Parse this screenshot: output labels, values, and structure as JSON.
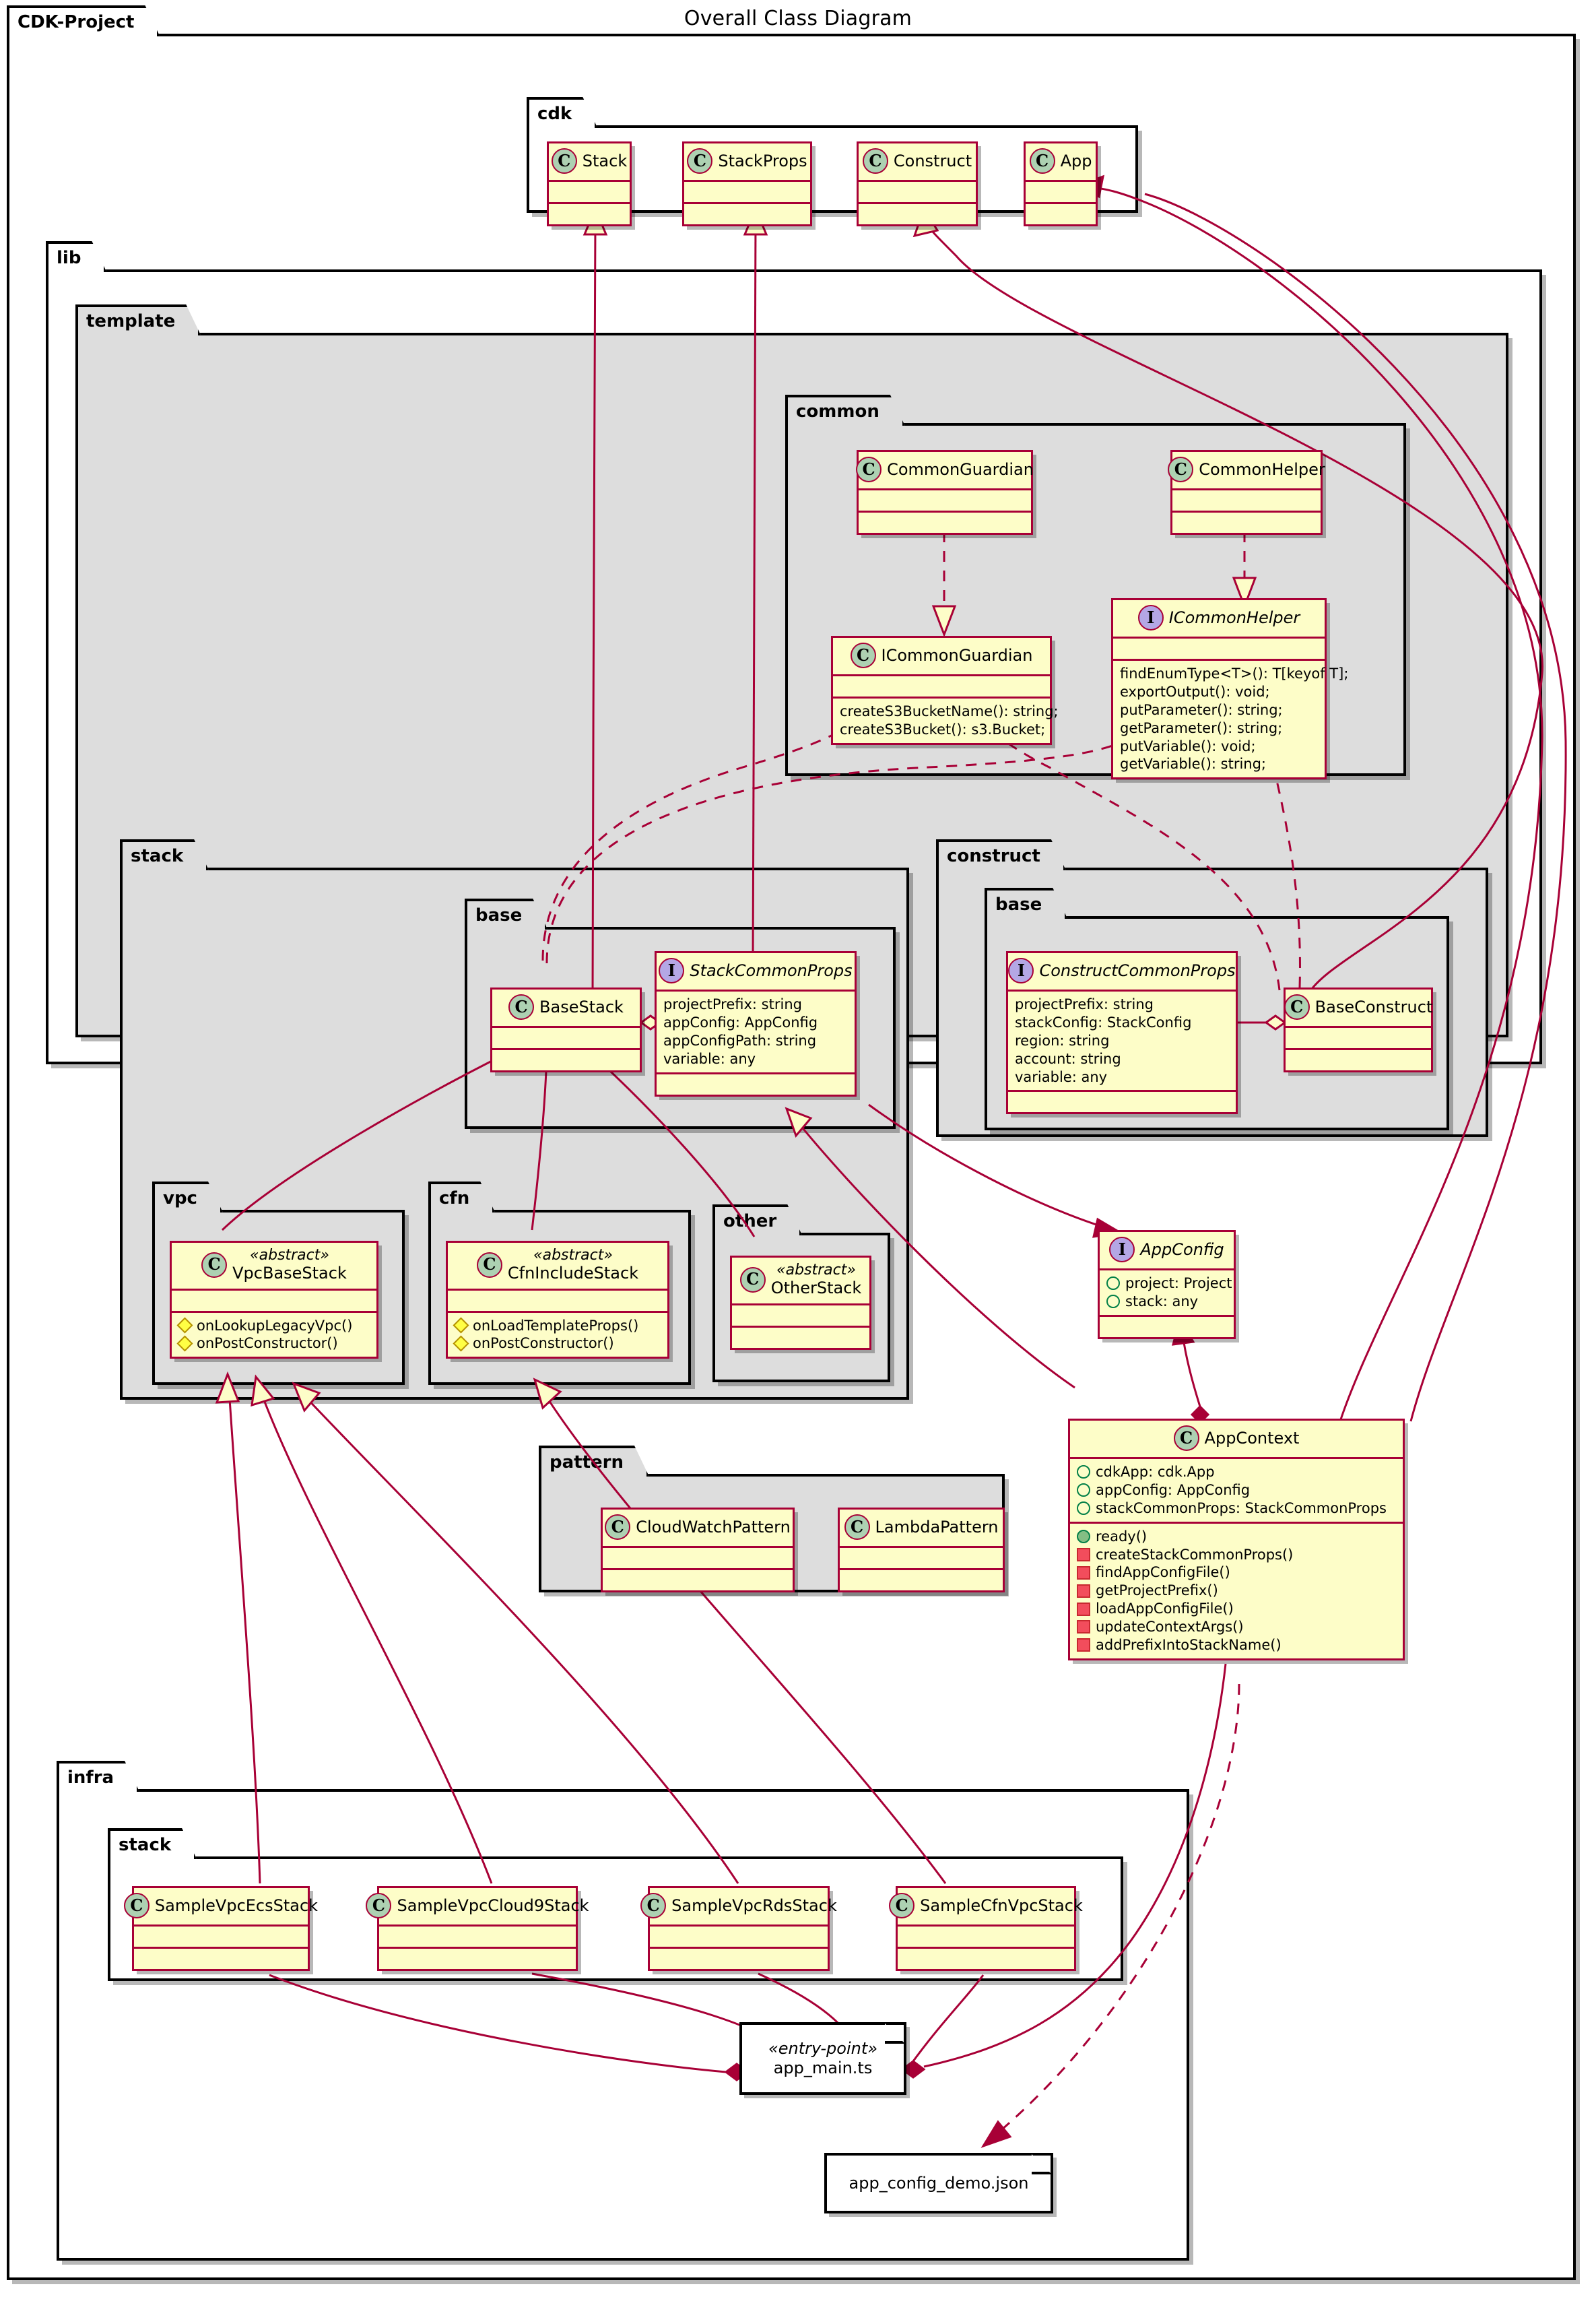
{
  "title": "Overall Class Diagram",
  "packages": {
    "cdk_project": "CDK-Project",
    "cdk": "cdk",
    "lib": "lib",
    "template": "template",
    "common": "common",
    "stack": "stack",
    "stack_base": "base",
    "construct": "construct",
    "construct_base": "base",
    "vpc": "vpc",
    "cfn": "cfn",
    "other": "other",
    "pattern": "pattern",
    "infra": "infra",
    "infra_stack": "stack"
  },
  "classes": {
    "stack": {
      "name": "Stack",
      "icon": "class-icon",
      "stereotype": "",
      "attributes": [],
      "methods": []
    },
    "stack_props": {
      "name": "StackProps",
      "icon": "class-icon",
      "stereotype": "",
      "attributes": [],
      "methods": []
    },
    "construct": {
      "name": "Construct",
      "icon": "class-icon",
      "stereotype": "",
      "attributes": [],
      "methods": []
    },
    "app": {
      "name": "App",
      "icon": "class-icon",
      "stereotype": "",
      "attributes": [],
      "methods": []
    },
    "common_guardian": {
      "name": "CommonGuardian",
      "icon": "class-icon",
      "stereotype": "",
      "attributes": [],
      "methods": []
    },
    "common_helper": {
      "name": "CommonHelper",
      "icon": "class-icon",
      "stereotype": "",
      "attributes": [],
      "methods": []
    },
    "i_common_guardian": {
      "name": "ICommonGuardian",
      "icon": "class-icon",
      "stereotype": "",
      "attributes": [],
      "methods": [
        {
          "visibility": "none",
          "text": "createS3BucketName(): string;"
        },
        {
          "visibility": "none",
          "text": "createS3Bucket(): s3.Bucket;"
        }
      ]
    },
    "i_common_helper": {
      "name": "ICommonHelper",
      "icon": "interface-icon",
      "stereotype": "",
      "attributes": [],
      "methods": [
        {
          "visibility": "none",
          "text": "findEnumType<T>(): T[keyof T];"
        },
        {
          "visibility": "none",
          "text": "exportOutput(): void;"
        },
        {
          "visibility": "none",
          "text": "putParameter(): string;"
        },
        {
          "visibility": "none",
          "text": "getParameter(): string;"
        },
        {
          "visibility": "none",
          "text": "putVariable(): void;"
        },
        {
          "visibility": "none",
          "text": "getVariable(): string;"
        }
      ]
    },
    "base_stack": {
      "name": "BaseStack",
      "icon": "class-icon",
      "stereotype": "",
      "attributes": [],
      "methods": []
    },
    "stack_common_props": {
      "name": "StackCommonProps",
      "icon": "interface-icon",
      "stereotype": "",
      "attributes": [
        {
          "visibility": "none",
          "text": "projectPrefix: string"
        },
        {
          "visibility": "none",
          "text": "appConfig: AppConfig"
        },
        {
          "visibility": "none",
          "text": "appConfigPath: string"
        },
        {
          "visibility": "none",
          "text": "variable: any"
        }
      ],
      "methods": []
    },
    "construct_common_props": {
      "name": "ConstructCommonProps",
      "icon": "interface-icon",
      "stereotype": "",
      "attributes": [
        {
          "visibility": "none",
          "text": "projectPrefix: string"
        },
        {
          "visibility": "none",
          "text": "stackConfig: StackConfig"
        },
        {
          "visibility": "none",
          "text": "region: string"
        },
        {
          "visibility": "none",
          "text": "account: string"
        },
        {
          "visibility": "none",
          "text": "variable: any"
        }
      ],
      "methods": []
    },
    "base_construct": {
      "name": "BaseConstruct",
      "icon": "class-icon",
      "stereotype": "",
      "attributes": [],
      "methods": []
    },
    "vpc_base_stack": {
      "name": "VpcBaseStack",
      "icon": "class-icon",
      "stereotype": "«abstract»",
      "attributes": [],
      "methods": [
        {
          "visibility": "protected",
          "text": "onLookupLegacyVpc()"
        },
        {
          "visibility": "protected",
          "text": "onPostConstructor()"
        }
      ]
    },
    "cfn_include_stack": {
      "name": "CfnIncludeStack",
      "icon": "class-icon",
      "stereotype": "«abstract»",
      "attributes": [],
      "methods": [
        {
          "visibility": "protected",
          "text": "onLoadTemplateProps()"
        },
        {
          "visibility": "protected",
          "text": "onPostConstructor()"
        }
      ]
    },
    "other_stack": {
      "name": "OtherStack",
      "icon": "class-icon",
      "stereotype": "«abstract»",
      "attributes": [],
      "methods": []
    },
    "app_config": {
      "name": "AppConfig",
      "icon": "interface-icon",
      "stereotype": "",
      "attributes": [
        {
          "visibility": "public",
          "text": "project: Project"
        },
        {
          "visibility": "public",
          "text": "stack: any"
        }
      ],
      "methods": []
    },
    "app_context": {
      "name": "AppContext",
      "icon": "class-icon",
      "stereotype": "",
      "attributes": [
        {
          "visibility": "public",
          "text": "cdkApp: cdk.App"
        },
        {
          "visibility": "public",
          "text": "appConfig: AppConfig"
        },
        {
          "visibility": "public",
          "text": "stackCommonProps: StackCommonProps"
        }
      ],
      "methods": [
        {
          "visibility": "public-filled",
          "text": "ready()"
        },
        {
          "visibility": "private",
          "text": "createStackCommonProps()"
        },
        {
          "visibility": "private",
          "text": "findAppConfigFile()"
        },
        {
          "visibility": "private",
          "text": "getProjectPrefix()"
        },
        {
          "visibility": "private",
          "text": "loadAppConfigFile()"
        },
        {
          "visibility": "private",
          "text": "updateContextArgs()"
        },
        {
          "visibility": "private",
          "text": "addPrefixIntoStackName()"
        }
      ]
    },
    "cloudwatch_pattern": {
      "name": "CloudWatchPattern",
      "icon": "class-icon",
      "stereotype": "",
      "attributes": [],
      "methods": []
    },
    "lambda_pattern": {
      "name": "LambdaPattern",
      "icon": "class-icon",
      "stereotype": "",
      "attributes": [],
      "methods": []
    },
    "sample_vpc_ecs_stack": {
      "name": "SampleVpcEcsStack",
      "icon": "class-icon",
      "stereotype": "",
      "attributes": [],
      "methods": []
    },
    "sample_vpc_cloud9_stack": {
      "name": "SampleVpcCloud9Stack",
      "icon": "class-icon",
      "stereotype": "",
      "attributes": [],
      "methods": []
    },
    "sample_vpc_rds_stack": {
      "name": "SampleVpcRdsStack",
      "icon": "class-icon",
      "stereotype": "",
      "attributes": [],
      "methods": []
    },
    "sample_cfn_vpc_stack": {
      "name": "SampleCfnVpcStack",
      "icon": "class-icon",
      "stereotype": "",
      "attributes": [],
      "methods": []
    }
  },
  "notes": {
    "app_main": {
      "stereotype": "«entry-point»",
      "name": "app_main.ts"
    },
    "app_config_demo": {
      "stereotype": "",
      "name": "app_config_demo.json"
    }
  },
  "colors": {
    "class_fill": "#fdfdc8",
    "class_border": "#a80036",
    "package_fill_grey": "#dddddd",
    "package_fill_white": "#ffffff",
    "class_icon_fill": "#add1b2",
    "interface_icon_fill": "#b4a7e5",
    "line": "#a80036"
  }
}
